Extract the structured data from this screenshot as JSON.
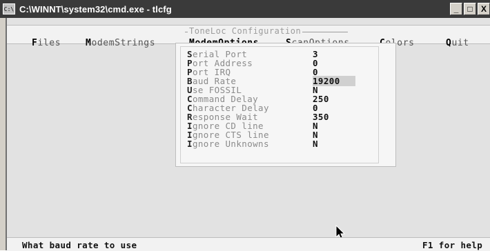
{
  "window": {
    "title": "C:\\WINNT\\system32\\cmd.exe - tlcfg",
    "icon_label": "C:\\",
    "buttons": {
      "minimize": "_",
      "maximize": "□",
      "close": "X"
    }
  },
  "app": {
    "frame_title": "ToneLoc Configuration"
  },
  "menu": [
    {
      "hotkey": "F",
      "rest": "iles"
    },
    {
      "hotkey": "M",
      "rest": "odemStrings"
    },
    {
      "hotkey": "M",
      "rest": "odemOptions"
    },
    {
      "hotkey": "S",
      "rest": "canOptions"
    },
    {
      "hotkey": "C",
      "rest": "olors"
    },
    {
      "hotkey": "Q",
      "rest": "uit"
    }
  ],
  "options": [
    {
      "key": "S",
      "rest": "erial Port",
      "value": "3"
    },
    {
      "key": "P",
      "rest": "ort Address",
      "value": "0"
    },
    {
      "key": "P",
      "rest": "ort IRQ",
      "value": "0"
    },
    {
      "key": "B",
      "rest": "aud Rate",
      "value": "19200"
    },
    {
      "key": "U",
      "rest": "se FOSSIL",
      "value": "N"
    },
    {
      "key": "C",
      "rest": "ommand Delay",
      "value": "250"
    },
    {
      "key": "C",
      "rest": "haracter Delay",
      "value": "0"
    },
    {
      "key": "R",
      "rest": "esponse Wait",
      "value": "350"
    },
    {
      "key": "I",
      "rest": "gnore CD line",
      "value": "N"
    },
    {
      "key": "I",
      "rest": "gnore CTS line",
      "value": "N"
    },
    {
      "key": "I",
      "rest": "gnore Unknowns",
      "value": "N"
    }
  ],
  "status": {
    "hint": "What baud rate to use",
    "help": "F1 for help"
  }
}
